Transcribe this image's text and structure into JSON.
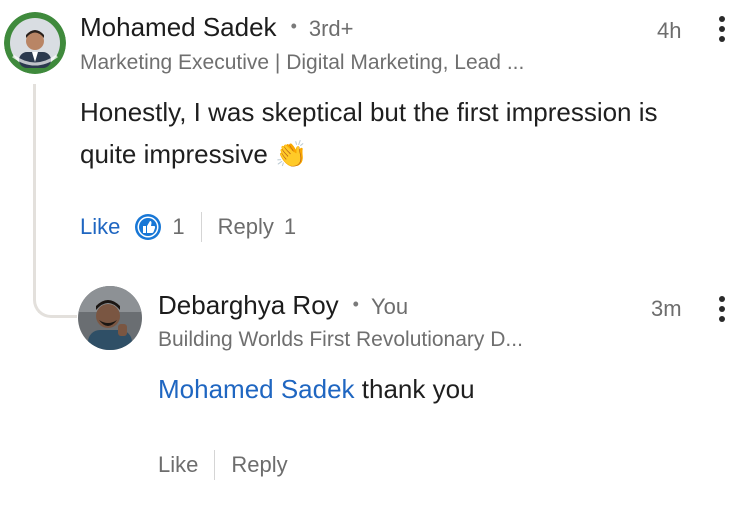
{
  "comment": {
    "author": "Mohamed Sadek",
    "separator": "•",
    "degree": "3rd+",
    "time": "4h",
    "headline": "Marketing Executive | Digital Marketing, Lead ...",
    "text": "Honestly, I was skeptical but the first impression is quite impressive",
    "emoji": "👏",
    "like_label": "Like",
    "reaction_count": "1",
    "reply_label": "Reply",
    "reply_count": "1"
  },
  "reply": {
    "author": "Debarghya Roy",
    "separator": "•",
    "badge": "You",
    "time": "3m",
    "headline": "Building Worlds First Revolutionary D...",
    "mention": "Mohamed Sadek",
    "text": " thank you",
    "like_label": "Like",
    "reply_label": "Reply"
  },
  "colors": {
    "link_blue": "#1f66c1",
    "reaction_blue": "#1877d6",
    "secondary_text": "#6d6d6d",
    "thread_line": "#e3e0dc"
  },
  "icons": {
    "reaction": "like-thumbs-up-icon",
    "menu": "more-vertical-icon"
  }
}
